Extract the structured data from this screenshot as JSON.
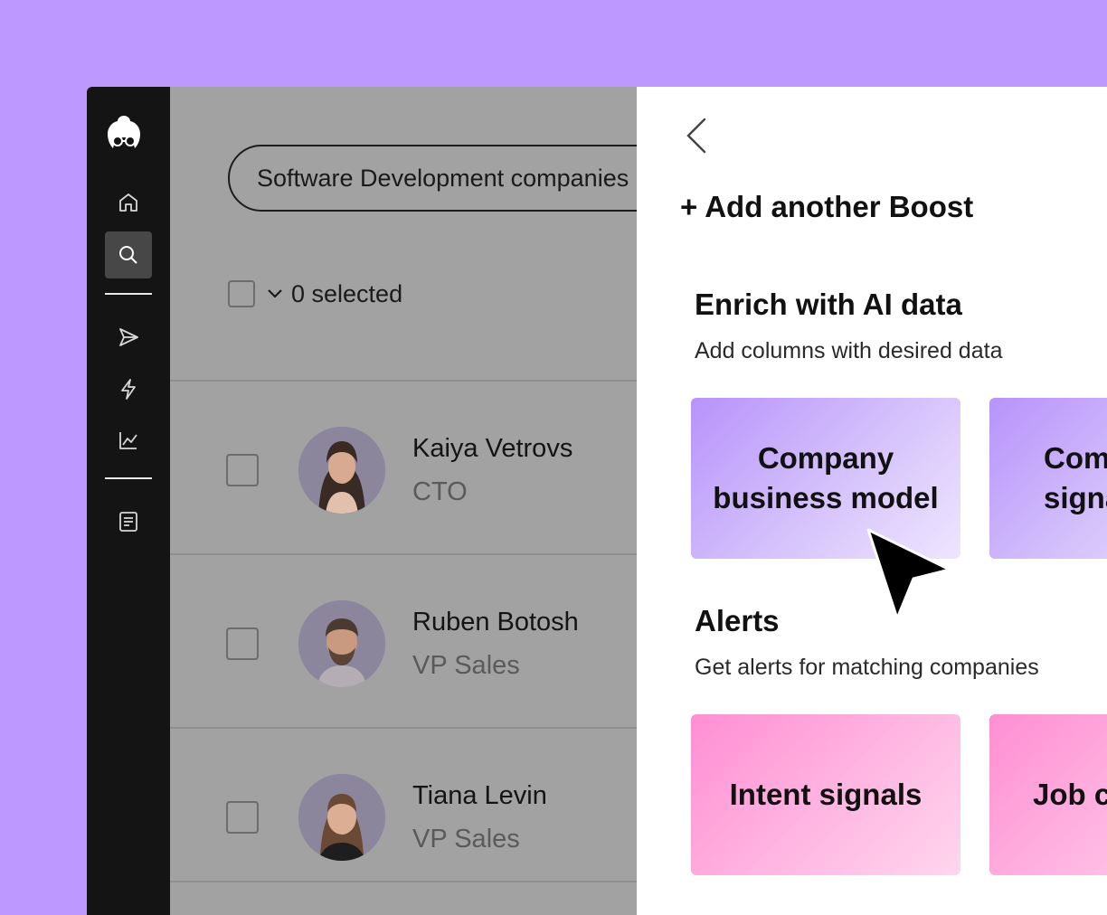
{
  "sidebar": {
    "logo": "brand-logo",
    "items": [
      {
        "icon": "home-icon"
      },
      {
        "icon": "search-icon",
        "active": true
      },
      {
        "icon": "send-icon"
      },
      {
        "icon": "lightning-icon"
      },
      {
        "icon": "chart-icon"
      },
      {
        "icon": "document-icon"
      }
    ]
  },
  "list": {
    "search_value": "Software Development companies",
    "selected_label": "0 selected",
    "people": [
      {
        "name": "Kaiya Vetrovs",
        "role": "CTO"
      },
      {
        "name": "Ruben Botosh",
        "role": "VP Sales"
      },
      {
        "name": "Tiana Levin",
        "role": "VP Sales"
      }
    ]
  },
  "panel": {
    "add_boost": "+ Add another Boost",
    "enrich": {
      "title": "Enrich with AI data",
      "subtitle": "Add columns with desired data",
      "cards": [
        "Company business model",
        "Com\nsigna"
      ]
    },
    "alerts": {
      "title": "Alerts",
      "subtitle": "Get alerts for matching companies",
      "cards": [
        "Intent signals",
        "Job c"
      ]
    }
  },
  "colors": {
    "background": "#bd99ff",
    "sidebar": "#141414",
    "card_purple": "#c5a8fb",
    "card_pink": "#ff9ed8"
  }
}
